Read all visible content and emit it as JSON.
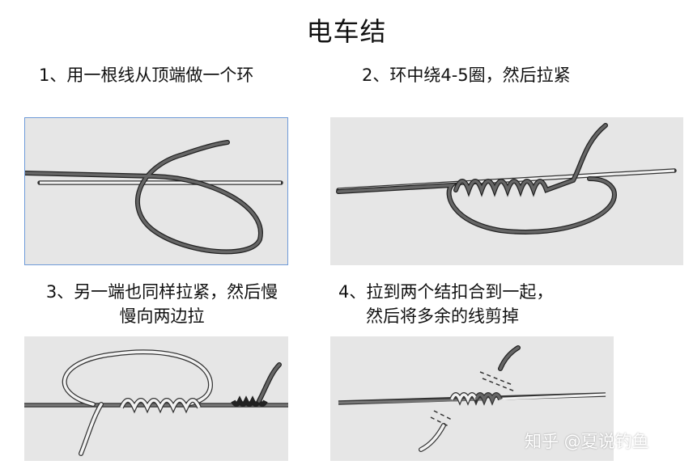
{
  "title": "电车结",
  "steps": [
    {
      "number": "1",
      "text": "1、用一根线从顶端做一个环"
    },
    {
      "number": "2",
      "text": "2、环中绕4-5圈，然后拉紧"
    },
    {
      "number": "3",
      "line1": "3、另一端也同样拉紧，然后慢",
      "line2": "慢向两边拉"
    },
    {
      "number": "4",
      "line1": "4、拉到两个结扣合到一起，",
      "line2": "然后将多余的线剪掉"
    }
  ],
  "watermark": "知乎 @夏说钓鱼",
  "colors": {
    "panel_bg": "#e6e6e6",
    "dark_line": "#555555",
    "light_line": "#eeeeee",
    "outline": "#333333",
    "selection_border": "#6f9bd8"
  }
}
